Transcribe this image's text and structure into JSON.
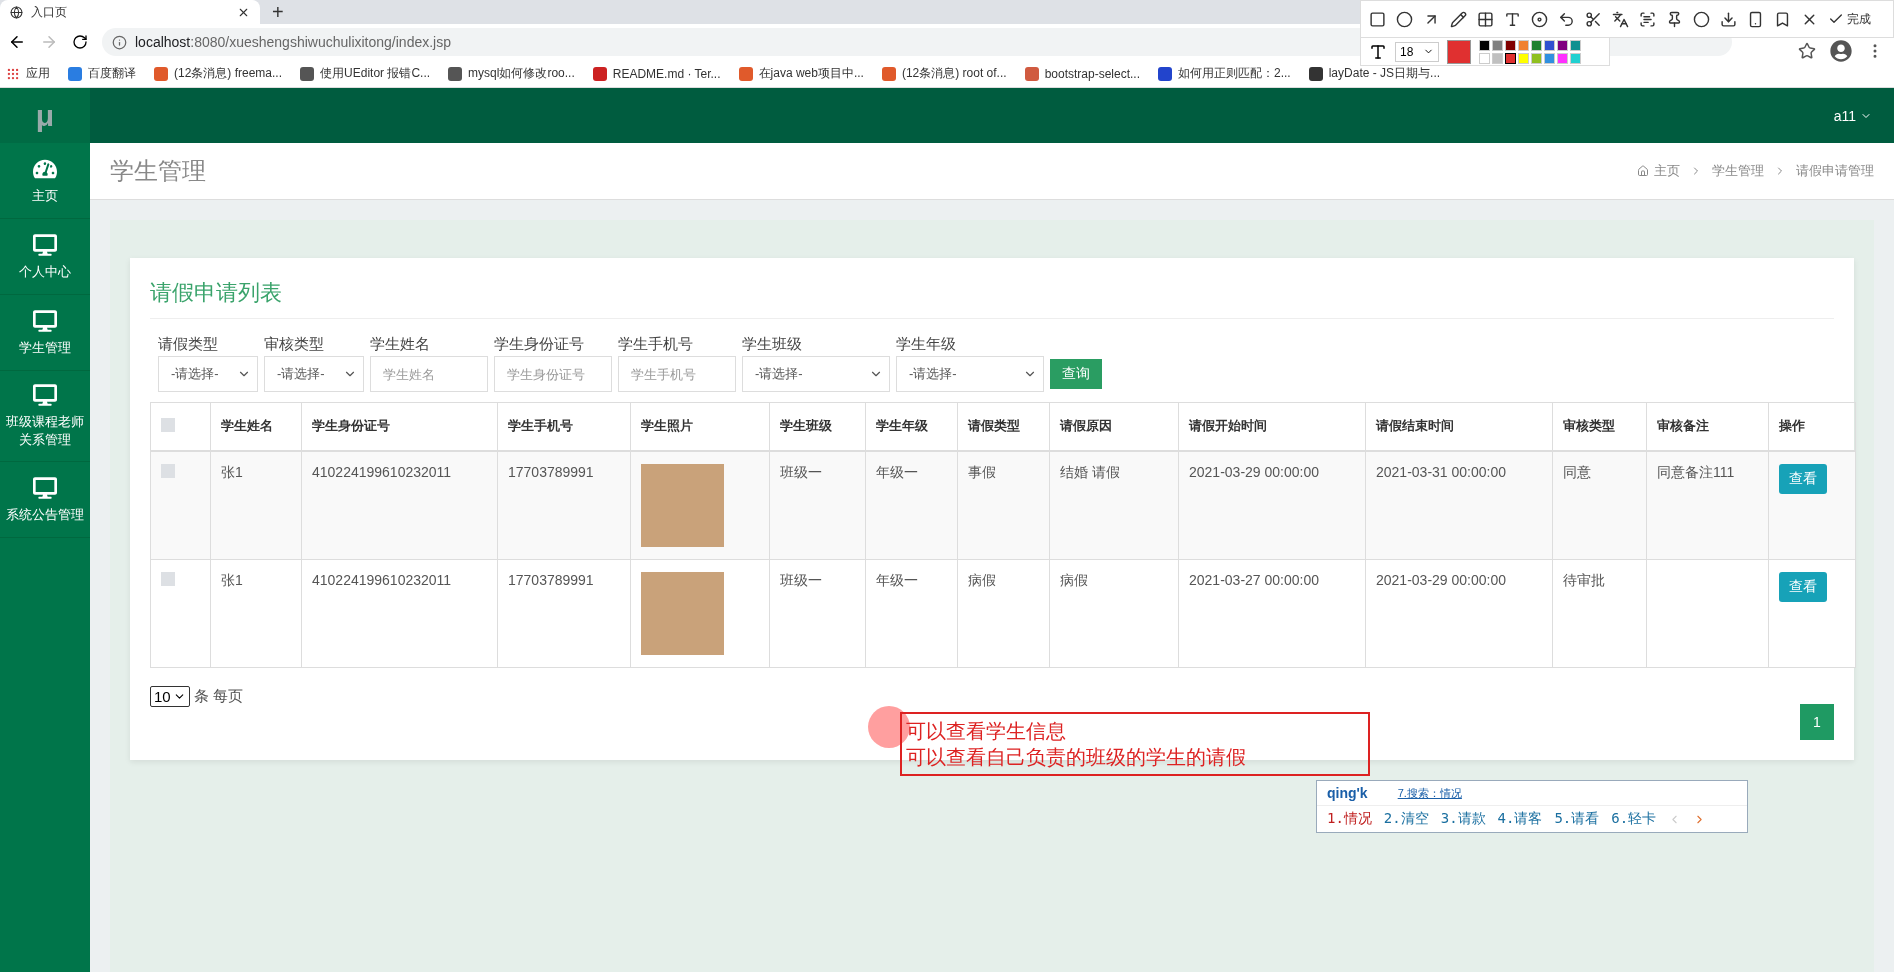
{
  "browser": {
    "tab_title": "入口页",
    "new_tab": "+",
    "url_host": "localhost",
    "url_rest": ":8080/xueshengshiwuchulixitong/index.jsp",
    "bookmarks": [
      {
        "label": "应用"
      },
      {
        "label": "百度翻译"
      },
      {
        "label": "(12条消息) freema..."
      },
      {
        "label": "使用UEditor 报错C..."
      },
      {
        "label": "mysql如何修改roo..."
      },
      {
        "label": "README.md · Ter..."
      },
      {
        "label": "在java web项目中..."
      },
      {
        "label": "(12条消息) root of..."
      },
      {
        "label": "bootstrap-select..."
      },
      {
        "label": "如何用正则匹配：2..."
      },
      {
        "label": "layDate - JS日期与..."
      }
    ]
  },
  "capture_toolbar": {
    "done_label": "完成",
    "font_size": "18",
    "palette": [
      {
        "color": "#000000",
        "selected": false
      },
      {
        "color": "#808080",
        "selected": false
      },
      {
        "color": "#800000",
        "selected": false
      },
      {
        "color": "#f08030",
        "selected": false
      },
      {
        "color": "#208030",
        "selected": false
      },
      {
        "color": "#3050d0",
        "selected": false
      },
      {
        "color": "#800080",
        "selected": false
      },
      {
        "color": "#109090",
        "selected": false
      },
      {
        "color": "#ffffff",
        "selected": false
      },
      {
        "color": "#c0c0c0",
        "selected": false
      },
      {
        "color": "#e03030",
        "selected": true
      },
      {
        "color": "#ffff00",
        "selected": false
      },
      {
        "color": "#90c020",
        "selected": false
      },
      {
        "color": "#3090e0",
        "selected": false
      },
      {
        "color": "#ff30ff",
        "selected": false
      },
      {
        "color": "#20d0d0",
        "selected": false
      }
    ]
  },
  "app": {
    "logo": "μ",
    "user": "a11",
    "sidebar": {
      "items": [
        {
          "kind": "dashboard",
          "label": "主页"
        },
        {
          "kind": "monitor",
          "label": "个人中心"
        },
        {
          "kind": "monitor",
          "label": "学生管理"
        },
        {
          "kind": "monitor",
          "label": "班级课程老师关系管理"
        },
        {
          "kind": "monitor",
          "label": "系统公告管理"
        }
      ]
    },
    "page_title": "学生管理",
    "breadcrumb": [
      "主页",
      "学生管理",
      "请假申请管理"
    ],
    "card_title": "请假申请列表",
    "filters": [
      {
        "kind": "select",
        "label": "请假类型",
        "value": "-请选择-"
      },
      {
        "kind": "select",
        "label": "审核类型",
        "value": "-请选择-"
      },
      {
        "kind": "input",
        "label": "学生姓名",
        "placeholder": "学生姓名"
      },
      {
        "kind": "input",
        "label": "学生身份证号",
        "placeholder": "学生身份证号"
      },
      {
        "kind": "input",
        "label": "学生手机号",
        "placeholder": "学生手机号"
      },
      {
        "kind": "select",
        "label": "学生班级",
        "value": "-请选择-"
      },
      {
        "kind": "select",
        "label": "学生年级",
        "value": "-请选择-"
      }
    ],
    "search_button": "查询",
    "table": {
      "all_checked": false,
      "columns": [
        "学生姓名",
        "学生身份证号",
        "学生手机号",
        "学生照片",
        "学生班级",
        "学生年级",
        "请假类型",
        "请假原因",
        "请假开始时间",
        "请假结束时间",
        "审核类型",
        "审核备注",
        "操作"
      ],
      "rows": [
        {
          "checked": false,
          "cells": [
            "张1",
            "410224199610232011",
            "17703789991",
            null,
            "班级一",
            "年级一",
            "事假",
            "结婚 请假",
            "2021-03-29 00:00:00",
            "2021-03-31 00:00:00",
            "同意",
            "同意备注111"
          ],
          "action": "查看"
        },
        {
          "checked": false,
          "cells": [
            "张1",
            "410224199610232011",
            "17703789991",
            null,
            "班级一",
            "年级一",
            "病假",
            "病假",
            "2021-03-27 00:00:00",
            "2021-03-29 00:00:00",
            "待审批"
          ],
          "action": "查看"
        }
      ]
    },
    "page_size": "10",
    "page_size_label": "条 每页",
    "pages": [
      {
        "label": "1",
        "selected": true
      }
    ],
    "annotation": {
      "lines": [
        "可以查看学生信息",
        "可以查看自己负责的班级的学生的请假"
      ]
    },
    "ime": {
      "input": "qing'k",
      "search": "7.搜索：情况",
      "candidates": [
        {
          "label": "1.情况",
          "selected": true
        },
        {
          "label": "2.清空",
          "selected": false
        },
        {
          "label": "3.请款",
          "selected": false
        },
        {
          "label": "4.请客",
          "selected": false
        },
        {
          "label": "5.请看",
          "selected": false
        },
        {
          "label": "6.轻卡",
          "selected": false
        }
      ]
    }
  }
}
